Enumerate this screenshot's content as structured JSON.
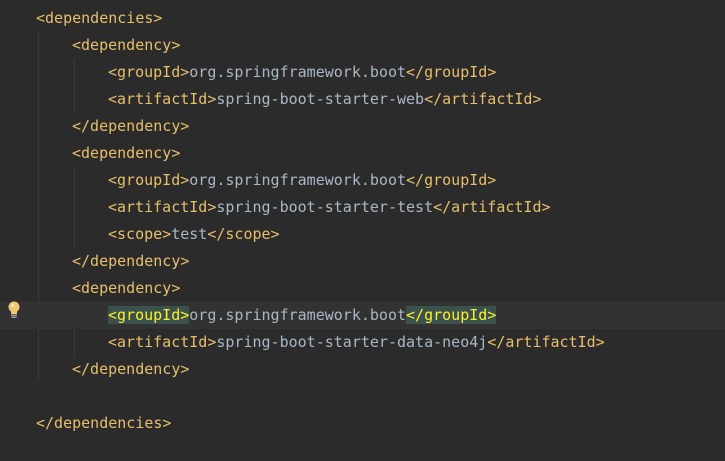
{
  "editor": {
    "language": "xml",
    "highlighted_line": 11,
    "lines": [
      {
        "indent": 0,
        "parts": [
          {
            "t": "tag",
            "v": "<dependencies>"
          }
        ]
      },
      {
        "indent": 1,
        "parts": [
          {
            "t": "tag",
            "v": "<dependency>"
          }
        ]
      },
      {
        "indent": 2,
        "parts": [
          {
            "t": "tag",
            "v": "<groupId>"
          },
          {
            "t": "txt",
            "v": "org.springframework.boot"
          },
          {
            "t": "tag",
            "v": "</groupId>"
          }
        ]
      },
      {
        "indent": 2,
        "parts": [
          {
            "t": "tag",
            "v": "<artifactId>"
          },
          {
            "t": "txt",
            "v": "spring-boot-starter-web"
          },
          {
            "t": "tag",
            "v": "</artifactId>"
          }
        ]
      },
      {
        "indent": 1,
        "parts": [
          {
            "t": "tag",
            "v": "</dependency>"
          }
        ]
      },
      {
        "indent": 1,
        "parts": [
          {
            "t": "tag",
            "v": "<dependency>"
          }
        ]
      },
      {
        "indent": 2,
        "parts": [
          {
            "t": "tag",
            "v": "<groupId>"
          },
          {
            "t": "txt",
            "v": "org.springframework.boot"
          },
          {
            "t": "tag",
            "v": "</groupId>"
          }
        ]
      },
      {
        "indent": 2,
        "parts": [
          {
            "t": "tag",
            "v": "<artifactId>"
          },
          {
            "t": "txt",
            "v": "spring-boot-starter-test"
          },
          {
            "t": "tag",
            "v": "</artifactId>"
          }
        ]
      },
      {
        "indent": 2,
        "parts": [
          {
            "t": "tag",
            "v": "<scope>"
          },
          {
            "t": "txt",
            "v": "test"
          },
          {
            "t": "tag",
            "v": "</scope>"
          }
        ]
      },
      {
        "indent": 1,
        "parts": [
          {
            "t": "tag",
            "v": "</dependency>"
          }
        ]
      },
      {
        "indent": 1,
        "parts": [
          {
            "t": "tag",
            "v": "<dependency>"
          }
        ]
      },
      {
        "indent": 2,
        "parts": [
          {
            "t": "match",
            "v": "<groupId>"
          },
          {
            "t": "txt",
            "v": "org.springframework.boot"
          },
          {
            "t": "match",
            "v": "</groupId>"
          }
        ]
      },
      {
        "indent": 2,
        "parts": [
          {
            "t": "tag",
            "v": "<artifactId>"
          },
          {
            "t": "txt",
            "v": "spring-boot-starter-data-neo4j"
          },
          {
            "t": "tag",
            "v": "</artifactId>"
          }
        ]
      },
      {
        "indent": 1,
        "parts": [
          {
            "t": "tag",
            "v": "</dependency>"
          }
        ]
      },
      {
        "indent": 0,
        "parts": []
      },
      {
        "indent": 0,
        "parts": [
          {
            "t": "tag",
            "v": "</dependencies>"
          }
        ]
      }
    ]
  },
  "gutter": {
    "intention_icon": "lightbulb-icon",
    "intention_line": 11
  },
  "colors": {
    "background": "#2b2b2b",
    "current_line": "#323232",
    "tag": "#e8bf6a",
    "text": "#a9b7c6",
    "match_bg": "#3b514d",
    "match_fg": "#ffef28",
    "bulb": "#f0c674"
  }
}
